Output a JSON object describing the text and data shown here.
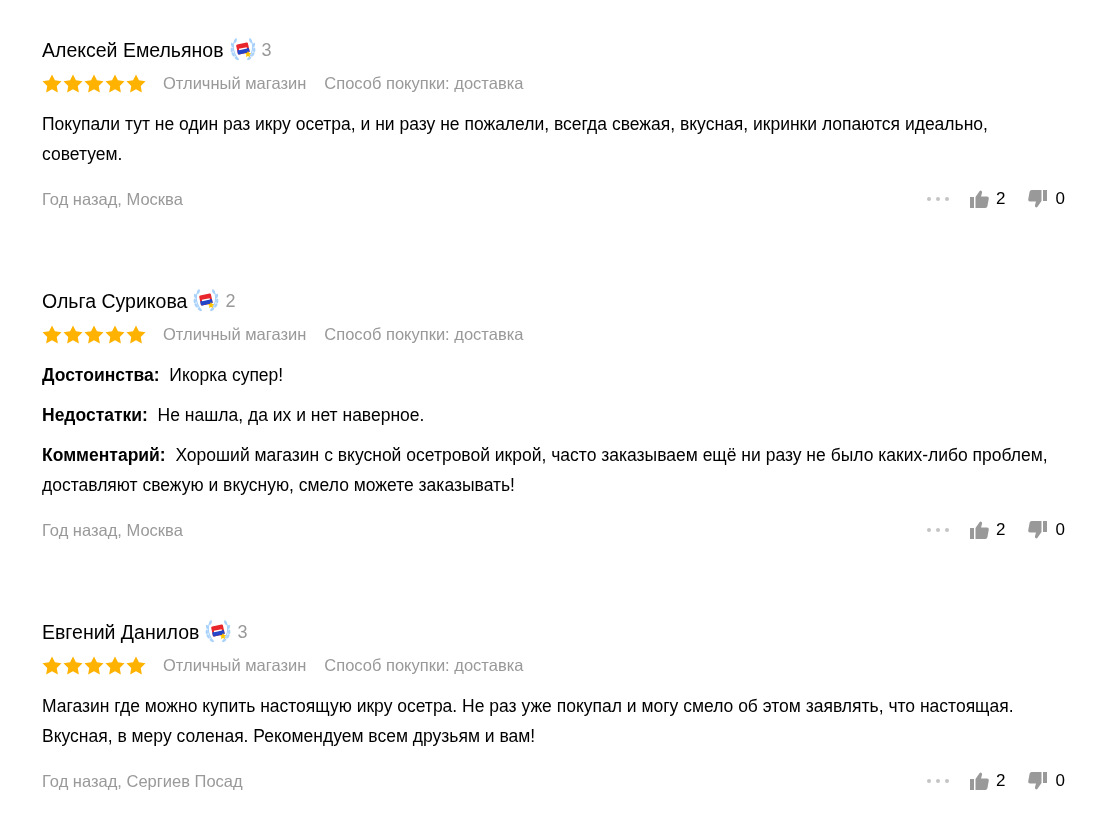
{
  "reviews": [
    {
      "author": "Алексей Емельянов",
      "badge_count": "3",
      "stars": 5,
      "grade": "Отличный магазин",
      "purchase": "Способ покупки: доставка",
      "paragraphs": [
        "Покупали тут не один раз икру осетра, и ни разу не пожалели, всегда свежая, вкусная, икринки лопаются идеально, советуем."
      ],
      "date_place": "Год назад, Москва",
      "likes": "2",
      "dislikes": "0"
    },
    {
      "author": "Ольга Сурикова",
      "badge_count": "2",
      "stars": 5,
      "grade": "Отличный магазин",
      "purchase": "Способ покупки: доставка",
      "paragraphs": [
        "**Достоинства:**  Икорка супер!",
        "**Недостатки:**  Не нашла, да их и нет наверное.",
        "**Комментарий:**  Хороший магазин с вкусной осетровой икрой, часто заказываем ещё ни разу не было каких-либо проблем, доставляют свежую и вкусную, смело можете заказывать!"
      ],
      "date_place": "Год назад, Москва",
      "likes": "2",
      "dislikes": "0"
    },
    {
      "author": "Евгений Данилов",
      "badge_count": "3",
      "stars": 5,
      "grade": "Отличный магазин",
      "purchase": "Способ покупки: доставка",
      "paragraphs": [
        "Магазин где можно купить настоящую икру осетра. Не раз уже покупал и могу смело об этом заявлять, что настоящая. Вкусная, в меру соленая. Рекомендуем всем друзьям и вам!"
      ],
      "date_place": "Год назад, Сергиев Посад",
      "likes": "2",
      "dislikes": "0"
    }
  ]
}
